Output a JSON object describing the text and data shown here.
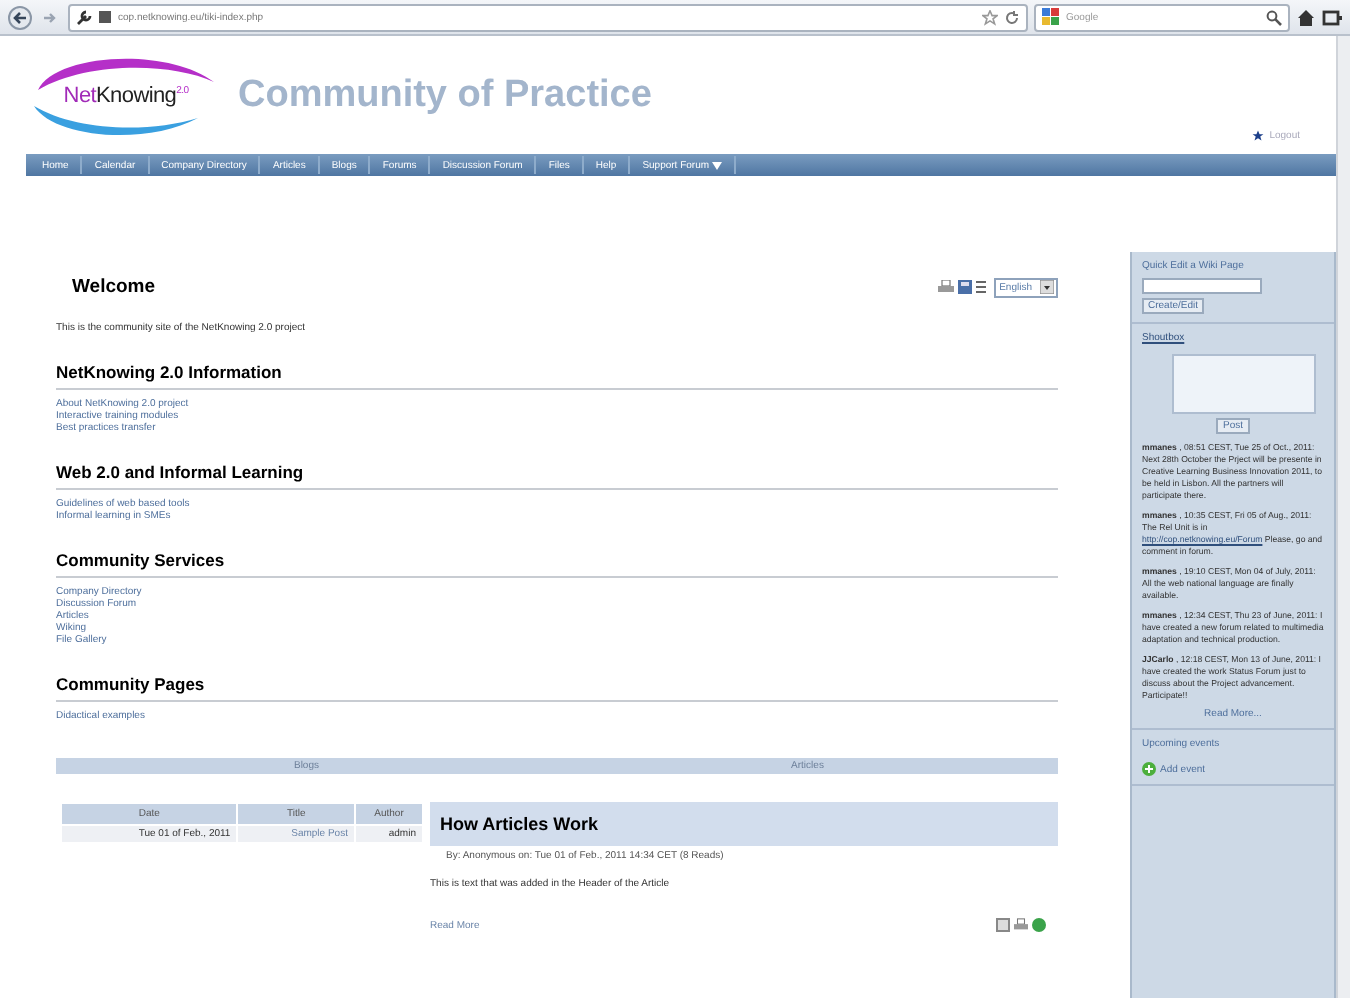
{
  "browser": {
    "url": "cop.netknowing.eu/tiki-index.php",
    "search_placeholder": "Google"
  },
  "header": {
    "logo_text": "NetKnowing",
    "logo_sup": "2.0",
    "title": "Community of Practice",
    "logout": "Logout"
  },
  "nav": [
    {
      "label": "Home",
      "has_menu": false
    },
    {
      "label": "Calendar",
      "has_menu": false
    },
    {
      "label": "Company Directory",
      "has_menu": false
    },
    {
      "label": "Articles",
      "has_menu": false
    },
    {
      "label": "Blogs",
      "has_menu": false
    },
    {
      "label": "Forums",
      "has_menu": false
    },
    {
      "label": "Discussion Forum",
      "has_menu": false
    },
    {
      "label": "Files",
      "has_menu": false
    },
    {
      "label": "Help",
      "has_menu": false
    },
    {
      "label": "Support Forum",
      "has_menu": true
    }
  ],
  "welcome": {
    "title": "Welcome",
    "language": "English",
    "intro": "This is the community site of the NetKnowing 2.0 project"
  },
  "sections": [
    {
      "title": "NetKnowing 2.0 Information",
      "links": [
        "About NetKnowing 2.0 project",
        "Interactive training modules",
        "Best practices transfer"
      ]
    },
    {
      "title": "Web 2.0 and Informal Learning",
      "links": [
        "Guidelines of web based tools",
        "Informal learning in SMEs"
      ]
    },
    {
      "title": "Community Services",
      "links": [
        "Company Directory",
        "Discussion Forum",
        "Articles",
        "Wiking",
        "File Gallery"
      ]
    },
    {
      "title": "Community Pages",
      "links": [
        "Didactical examples"
      ]
    }
  ],
  "bottom": {
    "tabs": [
      "Blogs",
      "Articles"
    ],
    "blog_table": {
      "columns": [
        "Date",
        "Title",
        "Author"
      ],
      "rows": [
        [
          "Tue 01 of Feb., 2011",
          "Sample Post",
          "admin"
        ]
      ]
    },
    "article": {
      "title": "How Articles Work",
      "byline": "By: Anonymous  on: Tue 01 of Feb., 2011 14:34 CET  (8 Reads)",
      "body": "This is text that was added in the Header of the Article",
      "read_more": "Read More"
    }
  },
  "sidebar": {
    "quick_edit": {
      "title": "Quick Edit a Wiki Page",
      "button": "Create/Edit"
    },
    "shoutbox": {
      "title": "Shoutbox",
      "button": "Post",
      "shouts": [
        {
          "text": "**mmanes** , 08:51 CEST, Tue 25 of Oct., 2011: Next 28th October the Prject will be presente in Creative Learning Business Innovation 2011, to be held in Lisbon. All the partners will participate there."
        },
        {
          "text": "**mmanes** , 10:35 CEST, Fri 05 of Aug., 2011: The Rel Unit is in",
          "link": "http://cop.netknowing.eu/Forum",
          "after": "Please, go and comment in forum."
        },
        {
          "text": "**mmanes** , 19:10 CEST, Mon 04 of July, 2011: All the web national language are finally available."
        },
        {
          "text": "**mmanes** , 12:34 CEST, Thu 23 of June, 2011: I have created a new forum related to multimedia adaptation and technical production."
        },
        {
          "text": "**JJCarlo** , 12:18 CEST, Mon 13 of June, 2011: I have created the work Status Forum just to discuss about the Project advancement. Participate!!"
        }
      ],
      "read_more": "Read More..."
    },
    "events": {
      "title": "Upcoming events",
      "add": "Add event"
    }
  }
}
